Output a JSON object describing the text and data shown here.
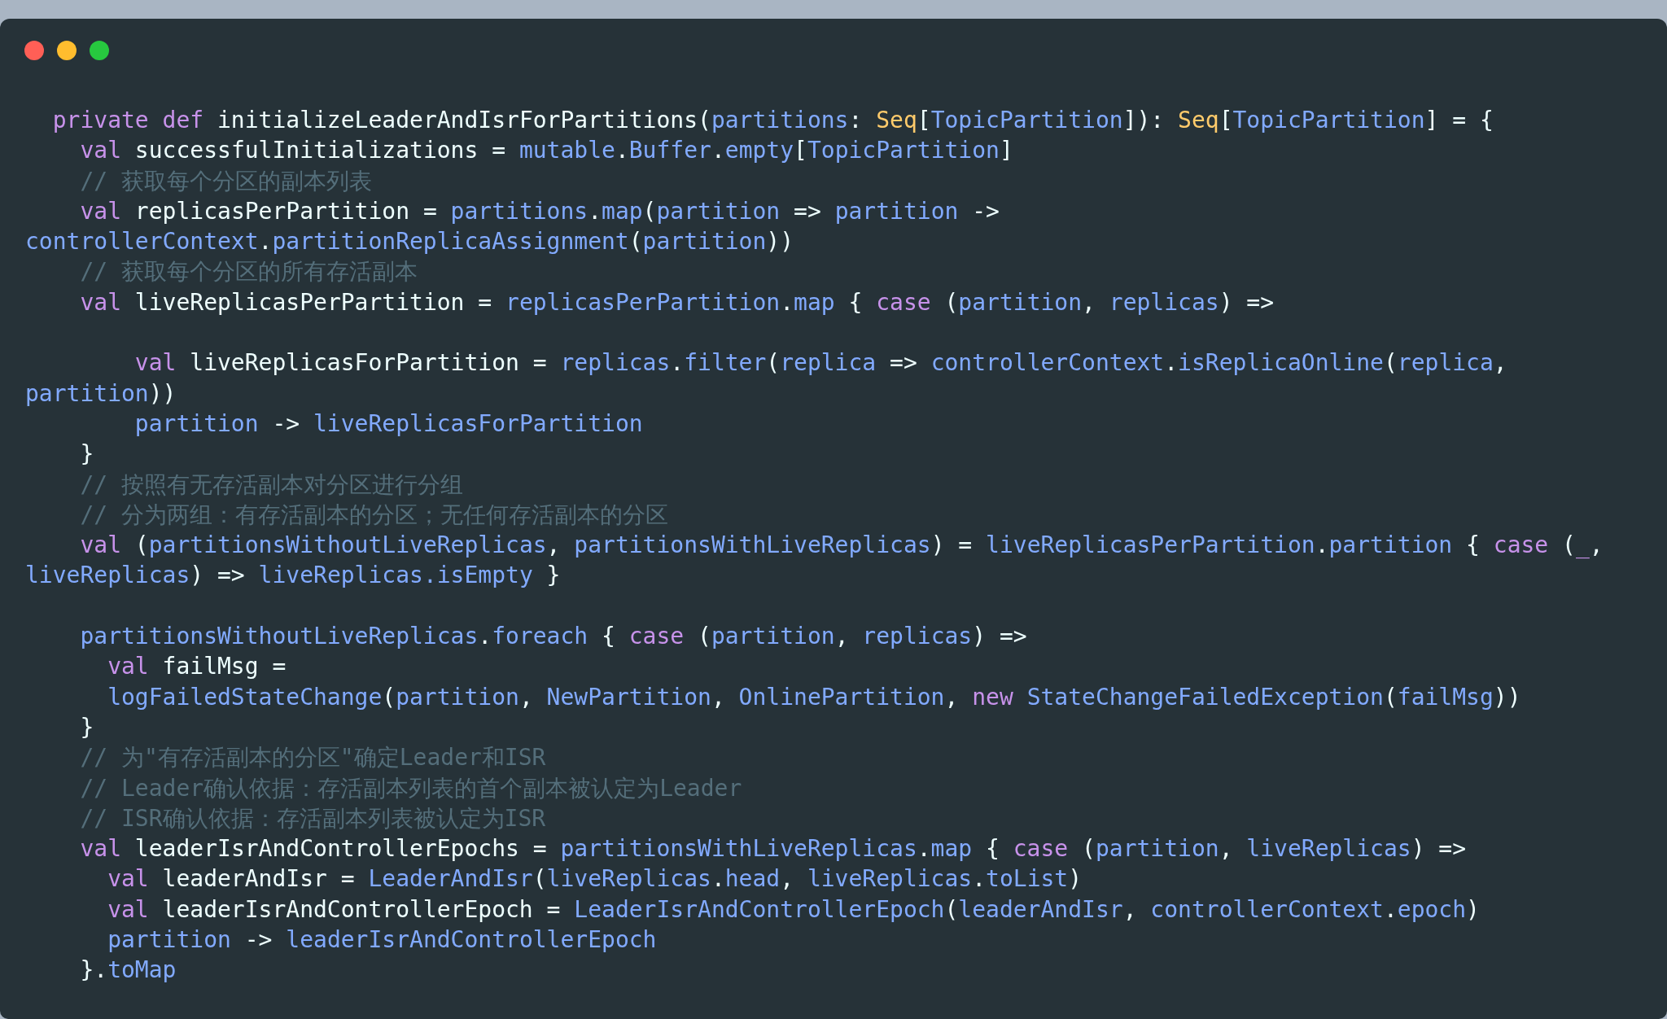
{
  "code": {
    "lines": [
      {
        "kind": "code",
        "tokens": [
          {
            "kind": "keyword",
            "text": "  private def"
          },
          {
            "kind": "plain",
            "text": " initializeLeaderAndIsrForPartitions("
          },
          {
            "kind": "name",
            "text": "partitions"
          },
          {
            "kind": "plain",
            "text": ": "
          },
          {
            "kind": "type",
            "text": "Seq"
          },
          {
            "kind": "plain",
            "text": "["
          },
          {
            "kind": "name",
            "text": "TopicPartition"
          },
          {
            "kind": "plain",
            "text": "]): "
          },
          {
            "kind": "type",
            "text": "Seq"
          },
          {
            "kind": "plain",
            "text": "["
          },
          {
            "kind": "name",
            "text": "TopicPartition"
          },
          {
            "kind": "plain",
            "text": "] = {"
          }
        ]
      },
      {
        "kind": "code",
        "tokens": [
          {
            "kind": "keyword",
            "text": "    val"
          },
          {
            "kind": "plain",
            "text": " successfulInitializations = "
          },
          {
            "kind": "name",
            "text": "mutable"
          },
          {
            "kind": "plain",
            "text": "."
          },
          {
            "kind": "name",
            "text": "Buffer"
          },
          {
            "kind": "plain",
            "text": "."
          },
          {
            "kind": "name",
            "text": "empty"
          },
          {
            "kind": "plain",
            "text": "["
          },
          {
            "kind": "name",
            "text": "TopicPartition"
          },
          {
            "kind": "plain",
            "text": "]"
          }
        ]
      },
      {
        "kind": "code",
        "tokens": [
          {
            "kind": "comment",
            "text": "    // 获取每个分区的副本列表"
          }
        ]
      },
      {
        "kind": "code",
        "tokens": [
          {
            "kind": "keyword",
            "text": "    val"
          },
          {
            "kind": "plain",
            "text": " replicasPerPartition = "
          },
          {
            "kind": "name",
            "text": "partitions"
          },
          {
            "kind": "plain",
            "text": "."
          },
          {
            "kind": "name",
            "text": "map"
          },
          {
            "kind": "plain",
            "text": "("
          },
          {
            "kind": "name",
            "text": "partition"
          },
          {
            "kind": "plain",
            "text": " => "
          },
          {
            "kind": "name",
            "text": "partition"
          },
          {
            "kind": "plain",
            "text": " ->"
          }
        ]
      },
      {
        "kind": "code",
        "tokens": [
          {
            "kind": "name",
            "text": "controllerContext"
          },
          {
            "kind": "plain",
            "text": "."
          },
          {
            "kind": "name",
            "text": "partitionReplicaAssignment"
          },
          {
            "kind": "plain",
            "text": "("
          },
          {
            "kind": "name",
            "text": "partition"
          },
          {
            "kind": "plain",
            "text": "))"
          }
        ]
      },
      {
        "kind": "code",
        "tokens": [
          {
            "kind": "comment",
            "text": "    // 获取每个分区的所有存活副本"
          }
        ]
      },
      {
        "kind": "code",
        "tokens": [
          {
            "kind": "keyword",
            "text": "    val"
          },
          {
            "kind": "plain",
            "text": " liveReplicasPerPartition = "
          },
          {
            "kind": "name",
            "text": "replicasPerPartition"
          },
          {
            "kind": "plain",
            "text": "."
          },
          {
            "kind": "name",
            "text": "map"
          },
          {
            "kind": "plain",
            "text": " { "
          },
          {
            "kind": "keyword",
            "text": "case"
          },
          {
            "kind": "plain",
            "text": " ("
          },
          {
            "kind": "name",
            "text": "partition"
          },
          {
            "kind": "plain",
            "text": ", "
          },
          {
            "kind": "name",
            "text": "replicas"
          },
          {
            "kind": "plain",
            "text": ") =>"
          }
        ]
      },
      {
        "kind": "blank"
      },
      {
        "kind": "code",
        "tokens": [
          {
            "kind": "keyword",
            "text": "        val"
          },
          {
            "kind": "plain",
            "text": " liveReplicasForPartition = "
          },
          {
            "kind": "name",
            "text": "replicas"
          },
          {
            "kind": "plain",
            "text": "."
          },
          {
            "kind": "name",
            "text": "filter"
          },
          {
            "kind": "plain",
            "text": "("
          },
          {
            "kind": "name",
            "text": "replica"
          },
          {
            "kind": "plain",
            "text": " => "
          },
          {
            "kind": "name",
            "text": "controllerContext"
          },
          {
            "kind": "plain",
            "text": "."
          },
          {
            "kind": "name",
            "text": "isReplicaOnline"
          },
          {
            "kind": "plain",
            "text": "("
          },
          {
            "kind": "name",
            "text": "replica"
          },
          {
            "kind": "plain",
            "text": ","
          }
        ]
      },
      {
        "kind": "code",
        "tokens": [
          {
            "kind": "name",
            "text": "partition"
          },
          {
            "kind": "plain",
            "text": "))"
          }
        ]
      },
      {
        "kind": "code",
        "tokens": [
          {
            "kind": "name",
            "text": "        partition"
          },
          {
            "kind": "plain",
            "text": " -> "
          },
          {
            "kind": "name",
            "text": "liveReplicasForPartition"
          }
        ]
      },
      {
        "kind": "code",
        "tokens": [
          {
            "kind": "plain",
            "text": "    }"
          }
        ]
      },
      {
        "kind": "code",
        "tokens": [
          {
            "kind": "comment",
            "text": "    // 按照有无存活副本对分区进行分组"
          }
        ]
      },
      {
        "kind": "code",
        "tokens": [
          {
            "kind": "comment",
            "text": "    // 分为两组：有存活副本的分区；无任何存活副本的分区"
          }
        ]
      },
      {
        "kind": "code",
        "tokens": [
          {
            "kind": "keyword",
            "text": "    val"
          },
          {
            "kind": "plain",
            "text": " ("
          },
          {
            "kind": "name",
            "text": "partitionsWithoutLiveReplicas"
          },
          {
            "kind": "plain",
            "text": ", "
          },
          {
            "kind": "name",
            "text": "partitionsWithLiveReplicas"
          },
          {
            "kind": "plain",
            "text": ") = "
          },
          {
            "kind": "name",
            "text": "liveReplicasPerPartition"
          },
          {
            "kind": "plain",
            "text": "."
          },
          {
            "kind": "name",
            "text": "partition"
          },
          {
            "kind": "plain",
            "text": " { "
          },
          {
            "kind": "keyword",
            "text": "case"
          },
          {
            "kind": "plain",
            "text": " ("
          },
          {
            "kind": "keyword",
            "text": "_"
          },
          {
            "kind": "plain",
            "text": ","
          }
        ]
      },
      {
        "kind": "code",
        "tokens": [
          {
            "kind": "name",
            "text": "liveReplicas"
          },
          {
            "kind": "plain",
            "text": ") => "
          },
          {
            "kind": "name",
            "text": "liveReplicas.isEmpty"
          },
          {
            "kind": "plain",
            "text": " }"
          }
        ]
      },
      {
        "kind": "blank"
      },
      {
        "kind": "code",
        "tokens": [
          {
            "kind": "name",
            "text": "    partitionsWithoutLiveReplicas"
          },
          {
            "kind": "plain",
            "text": "."
          },
          {
            "kind": "name",
            "text": "foreach"
          },
          {
            "kind": "plain",
            "text": " { "
          },
          {
            "kind": "keyword",
            "text": "case"
          },
          {
            "kind": "plain",
            "text": " ("
          },
          {
            "kind": "name",
            "text": "partition"
          },
          {
            "kind": "plain",
            "text": ", "
          },
          {
            "kind": "name",
            "text": "replicas"
          },
          {
            "kind": "plain",
            "text": ") =>"
          }
        ]
      },
      {
        "kind": "code",
        "tokens": [
          {
            "kind": "keyword",
            "text": "      val"
          },
          {
            "kind": "plain",
            "text": " failMsg ="
          }
        ]
      },
      {
        "kind": "code",
        "tokens": [
          {
            "kind": "name",
            "text": "      logFailedStateChange"
          },
          {
            "kind": "plain",
            "text": "("
          },
          {
            "kind": "name",
            "text": "partition"
          },
          {
            "kind": "plain",
            "text": ", "
          },
          {
            "kind": "name",
            "text": "NewPartition"
          },
          {
            "kind": "plain",
            "text": ", "
          },
          {
            "kind": "name",
            "text": "OnlinePartition"
          },
          {
            "kind": "plain",
            "text": ", "
          },
          {
            "kind": "keyword",
            "text": "new"
          },
          {
            "kind": "name",
            "text": " StateChangeFailedException"
          },
          {
            "kind": "plain",
            "text": "("
          },
          {
            "kind": "name",
            "text": "failMsg"
          },
          {
            "kind": "plain",
            "text": "))"
          }
        ]
      },
      {
        "kind": "code",
        "tokens": [
          {
            "kind": "plain",
            "text": "    }"
          }
        ]
      },
      {
        "kind": "code",
        "tokens": [
          {
            "kind": "comment",
            "text": "    // 为\"有存活副本的分区\"确定Leader和ISR"
          }
        ]
      },
      {
        "kind": "code",
        "tokens": [
          {
            "kind": "comment",
            "text": "    // Leader确认依据：存活副本列表的首个副本被认定为Leader"
          }
        ]
      },
      {
        "kind": "code",
        "tokens": [
          {
            "kind": "comment",
            "text": "    // ISR确认依据：存活副本列表被认定为ISR"
          }
        ]
      },
      {
        "kind": "code",
        "tokens": [
          {
            "kind": "keyword",
            "text": "    val"
          },
          {
            "kind": "plain",
            "text": " leaderIsrAndControllerEpochs = "
          },
          {
            "kind": "name",
            "text": "partitionsWithLiveReplicas"
          },
          {
            "kind": "plain",
            "text": "."
          },
          {
            "kind": "name",
            "text": "map"
          },
          {
            "kind": "plain",
            "text": " { "
          },
          {
            "kind": "keyword",
            "text": "case"
          },
          {
            "kind": "plain",
            "text": " ("
          },
          {
            "kind": "name",
            "text": "partition"
          },
          {
            "kind": "plain",
            "text": ", "
          },
          {
            "kind": "name",
            "text": "liveReplicas"
          },
          {
            "kind": "plain",
            "text": ") =>"
          }
        ]
      },
      {
        "kind": "code",
        "tokens": [
          {
            "kind": "keyword",
            "text": "      val"
          },
          {
            "kind": "plain",
            "text": " leaderAndIsr = "
          },
          {
            "kind": "name",
            "text": "LeaderAndIsr"
          },
          {
            "kind": "plain",
            "text": "("
          },
          {
            "kind": "name",
            "text": "liveReplicas"
          },
          {
            "kind": "plain",
            "text": "."
          },
          {
            "kind": "name",
            "text": "head"
          },
          {
            "kind": "plain",
            "text": ", "
          },
          {
            "kind": "name",
            "text": "liveReplicas"
          },
          {
            "kind": "plain",
            "text": "."
          },
          {
            "kind": "name",
            "text": "toList"
          },
          {
            "kind": "plain",
            "text": ")"
          }
        ]
      },
      {
        "kind": "code",
        "tokens": [
          {
            "kind": "keyword",
            "text": "      val"
          },
          {
            "kind": "plain",
            "text": " leaderIsrAndControllerEpoch = "
          },
          {
            "kind": "name",
            "text": "LeaderIsrAndControllerEpoch"
          },
          {
            "kind": "plain",
            "text": "("
          },
          {
            "kind": "name",
            "text": "leaderAndIsr"
          },
          {
            "kind": "plain",
            "text": ", "
          },
          {
            "kind": "name",
            "text": "controllerContext"
          },
          {
            "kind": "plain",
            "text": "."
          },
          {
            "kind": "name",
            "text": "epoch"
          },
          {
            "kind": "plain",
            "text": ")"
          }
        ]
      },
      {
        "kind": "code",
        "tokens": [
          {
            "kind": "name",
            "text": "      partition"
          },
          {
            "kind": "plain",
            "text": " -> "
          },
          {
            "kind": "name",
            "text": "leaderIsrAndControllerEpoch"
          }
        ]
      },
      {
        "kind": "code",
        "tokens": [
          {
            "kind": "plain",
            "text": "    }."
          },
          {
            "kind": "name",
            "text": "toMap"
          }
        ]
      }
    ]
  }
}
